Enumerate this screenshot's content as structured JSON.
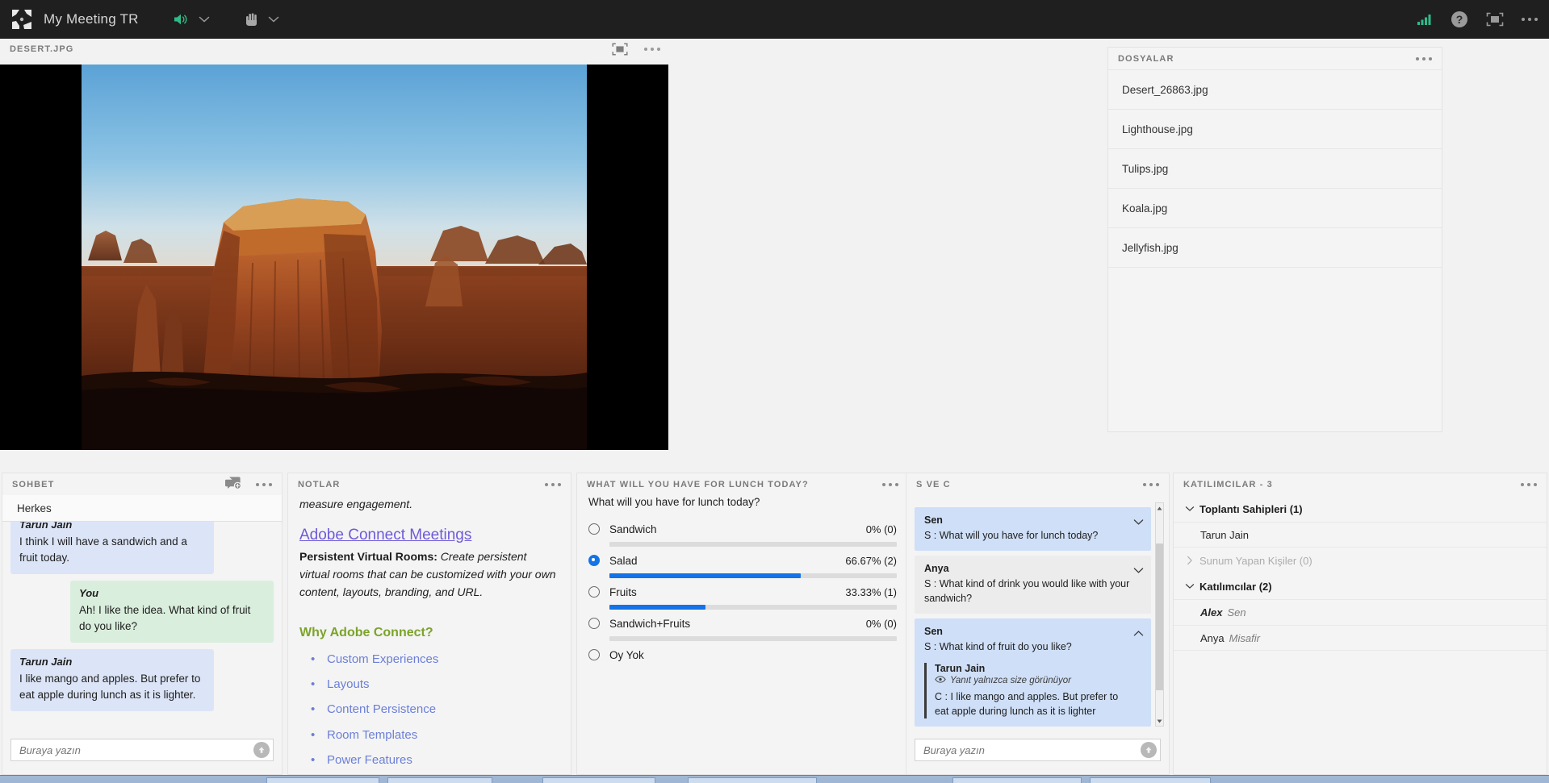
{
  "topbar": {
    "logo_icon": "adobe-connect-logo",
    "title": "My Meeting TR",
    "speaker_icon": "speaker-on-icon",
    "speaker_chevron_icon": "chevron-down-icon",
    "hand_icon": "raise-hand-icon",
    "hand_chevron_icon": "chevron-down-icon",
    "signal_icon": "connection-signal-icon",
    "help_icon": "help-circle-icon",
    "fullscreen_icon": "fullscreen-icon",
    "menu_icon": "more-options-icon",
    "accent_green": "#2fbb89"
  },
  "share_pod": {
    "title": "DESERT.JPG",
    "fullscreen_icon": "fullscreen-icon",
    "menu_icon": "more-options-icon",
    "image_alt": "desert-butte-photo"
  },
  "files_pod": {
    "title": "DOSYALAR",
    "menu_icon": "more-options-icon",
    "files": [
      "Desert_26863.jpg",
      "Lighthouse.jpg",
      "Tulips.jpg",
      "Koala.jpg",
      "Jellyfish.jpg"
    ]
  },
  "chat_pod": {
    "title": "SOHBET",
    "new_chat_icon": "new-chat-icon",
    "menu_icon": "more-options-icon",
    "tab": "Herkes",
    "messages": [
      {
        "sender": "Tarun Jain",
        "text": "I think I will have a sandwich and a fruit today.",
        "self": false
      },
      {
        "sender": "You",
        "text": "Ah! I like the idea. What kind of fruit do you like?",
        "self": true
      },
      {
        "sender": "Tarun Jain",
        "text": "I like mango and apples. But prefer to eat apple during lunch as it is lighter.",
        "self": false
      }
    ],
    "input_placeholder": "Buraya yazın",
    "send_icon": "send-arrow-icon"
  },
  "notes_pod": {
    "title": "NOTLAR",
    "menu_icon": "more-options-icon",
    "clipped_line": "measure engagement.",
    "link": "Adobe Connect Meetings",
    "bold_lead": "Persistent Virtual Rooms:",
    "italic_body": " Create persistent virtual rooms that can be customized with your own content, layouts, branding, and URL.",
    "heading": "Why Adobe Connect?",
    "bullets": [
      "Custom Experiences",
      "Layouts",
      "Content Persistence",
      "Room Templates",
      "Power Features"
    ]
  },
  "poll_pod": {
    "title": "WHAT WILL YOU HAVE FOR LUNCH TODAY?",
    "menu_icon": "more-options-icon",
    "question": "What will you have for lunch today?",
    "options": [
      {
        "label": "Sandwich",
        "percent": "0% (0)",
        "value": 0,
        "selected": false,
        "has_bar": true
      },
      {
        "label": "Salad",
        "percent": "66.67% (2)",
        "value": 66.67,
        "selected": true,
        "has_bar": true
      },
      {
        "label": "Fruits",
        "percent": "33.33% (1)",
        "value": 33.33,
        "selected": false,
        "has_bar": true
      },
      {
        "label": "Sandwich+Fruits",
        "percent": "0% (0)",
        "value": 0,
        "selected": false,
        "has_bar": true
      },
      {
        "label": "Oy Yok",
        "percent": "",
        "value": 0,
        "selected": false,
        "has_bar": false
      }
    ]
  },
  "qa_pod": {
    "title": "S VE C",
    "menu_icon": "more-options-icon",
    "items": [
      {
        "name": "Sen",
        "text": "S : What will you have for lunch today?",
        "style": "blue",
        "chevron": "chevron-down-icon",
        "expanded": false
      },
      {
        "name": "Anya",
        "text": "S : What kind of drink you would like with your sandwich?",
        "style": "grey",
        "chevron": "chevron-down-icon",
        "expanded": false
      },
      {
        "name": "Sen",
        "text": "S : What kind of fruit do you like?",
        "style": "blue",
        "chevron": "chevron-up-icon",
        "expanded": true,
        "answer": {
          "name": "Tarun Jain",
          "privacy_icon": "eye-icon",
          "privacy": "Yanıt yalnızca size görünüyor",
          "text": "C : I like mango and apples. But prefer to eat apple during lunch as it is lighter"
        }
      }
    ],
    "input_placeholder": "Buraya yazın",
    "send_icon": "send-arrow-icon",
    "scroll_up_icon": "scroll-up-arrow-icon",
    "scroll_down_icon": "scroll-down-arrow-icon"
  },
  "attendees_pod": {
    "title": "KATILIMCILAR - 3",
    "menu_icon": "more-options-icon",
    "groups": [
      {
        "label": "Toplantı Sahipleri (1)",
        "chevron": "chevron-down-icon",
        "dim": false,
        "members": [
          {
            "name": "Tarun Jain",
            "role": "",
            "italic": false
          }
        ]
      },
      {
        "label": "Sunum Yapan Kişiler (0)",
        "chevron": "chevron-right-icon",
        "dim": true,
        "members": []
      },
      {
        "label": "Katılımcılar (2)",
        "chevron": "chevron-down-icon",
        "dim": false,
        "members": [
          {
            "name": "Alex",
            "role": "Sen",
            "italic": true
          },
          {
            "name": "Anya",
            "role": "Misafir",
            "italic": false
          }
        ]
      }
    ]
  }
}
